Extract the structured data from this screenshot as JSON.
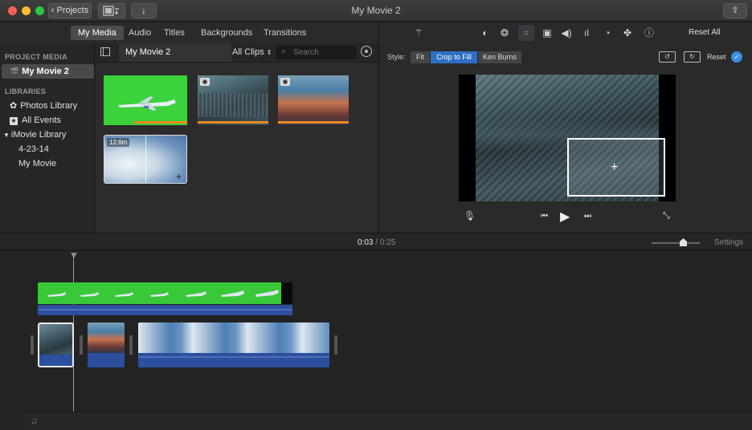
{
  "window": {
    "title": "My Movie 2",
    "projects_label": "Projects",
    "projects_chevron": "‹"
  },
  "tabs": [
    {
      "label": "My Media",
      "active": true
    },
    {
      "label": "Audio"
    },
    {
      "label": "Titles"
    },
    {
      "label": "Backgrounds"
    },
    {
      "label": "Transitions"
    }
  ],
  "sidebar": {
    "project_media_header": "PROJECT MEDIA",
    "project_item": "My Movie 2",
    "libraries_header": "LIBRARIES",
    "items": [
      {
        "label": "Photos Library",
        "icon": "photos-icon"
      },
      {
        "label": "All Events",
        "icon": "star-icon"
      },
      {
        "label": "iMovie Library",
        "icon": "disclosure-triangle-icon"
      },
      {
        "label": "4-23-14"
      },
      {
        "label": "My Movie"
      }
    ]
  },
  "browser": {
    "project_name": "My Movie 2",
    "filter": "All Clips",
    "search_placeholder": "Search",
    "clips": [
      {
        "kind": "greenscreen-plane"
      },
      {
        "kind": "city-aerial",
        "badge": "camera"
      },
      {
        "kind": "mountain-aerial",
        "badge": "camera"
      },
      {
        "kind": "clouds",
        "duration": "12.6m"
      }
    ]
  },
  "viewer": {
    "reset_all": "Reset All",
    "reset": "Reset",
    "style_label": "Style:",
    "style_options": [
      "Fit",
      "Crop to Fill",
      "Ken Burns"
    ],
    "style_selected": "Crop to Fill"
  },
  "timeline": {
    "current_time": "0:03",
    "separator": "/",
    "total_time": "0:25",
    "settings_label": "Settings",
    "zoom_level": 0.65
  },
  "colors": {
    "accent": "#2f6fc4",
    "greenscreen": "#33cc33",
    "audio": "#2c4f9e",
    "clip_selected_border": "#e8e8e8"
  }
}
